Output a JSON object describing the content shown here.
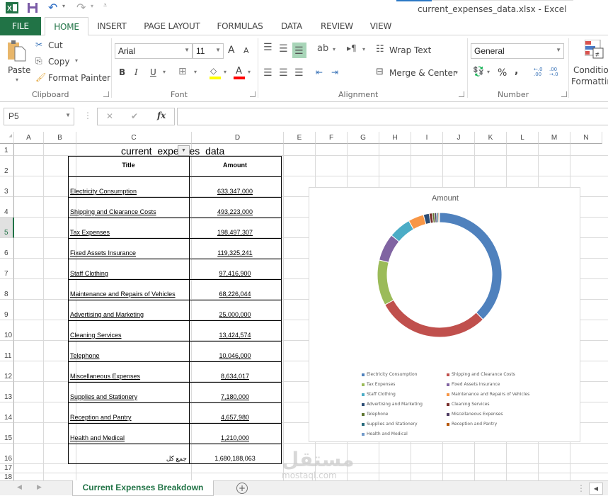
{
  "window": {
    "title": "current_expenses_data.xlsx - Excel"
  },
  "ribbon_tabs": [
    "FILE",
    "HOME",
    "INSERT",
    "PAGE LAYOUT",
    "FORMULAS",
    "DATA",
    "REVIEW",
    "VIEW"
  ],
  "active_tab": "HOME",
  "clipboard": {
    "paste": "Paste",
    "cut": "Cut",
    "copy": "Copy",
    "format_painter": "Format Painter",
    "label": "Clipboard"
  },
  "font": {
    "name": "Arial",
    "size": "11",
    "bold": "B",
    "italic": "I",
    "underline": "U",
    "label": "Font",
    "grow": "A",
    "shrink": "A",
    "color_letter": "A",
    "fill_color": "#ffff00",
    "text_color": "#ff0000"
  },
  "alignment": {
    "wrap_text": "Wrap Text",
    "merge_center": "Merge & Center",
    "label": "Alignment"
  },
  "number": {
    "format": "General",
    "percent": "%",
    "comma": ",",
    "inc_decimal": "←.0 .00",
    "dec_decimal": ".00 →.0",
    "label": "Number"
  },
  "styles": {
    "conditional_formatting_1": "Conditior",
    "conditional_formatting_2": "Formattin"
  },
  "formula_bar": {
    "name_box": "P5",
    "cancel": "✕",
    "enter": "✔",
    "fx": "fx",
    "value": ""
  },
  "columns": [
    "A",
    "B",
    "C",
    "D",
    "E",
    "F",
    "G",
    "H",
    "I",
    "J",
    "K",
    "L",
    "M",
    "N"
  ],
  "rows": [
    "1",
    "2",
    "3",
    "4",
    "5",
    "6",
    "7",
    "8",
    "9",
    "10",
    "11",
    "12",
    "13",
    "14",
    "15",
    "16",
    "17",
    "18"
  ],
  "selected_row": "5",
  "sheet": {
    "title": "current_expenses_data",
    "headers": {
      "title": "Title",
      "amount": "Amount"
    },
    "items": [
      {
        "title": "Electricity Consumption",
        "amount": "633,347,000"
      },
      {
        "title": "Shipping and Clearance Costs",
        "amount": "493,223,000"
      },
      {
        "title": "Tax Expenses",
        "amount": "198,497,307"
      },
      {
        "title": "Fixed Assets Insurance",
        "amount": "119,325,241"
      },
      {
        "title": "Staff Clothing",
        "amount": "97,416,900"
      },
      {
        "title": "Maintenance and Repairs of Vehicles",
        "amount": "68,226,044"
      },
      {
        "title": "Advertising and Marketing",
        "amount": "25,000,000"
      },
      {
        "title": "Cleaning Services",
        "amount": "13,424,574"
      },
      {
        "title": "Telephone",
        "amount": "10,046,000"
      },
      {
        "title": "Miscellaneous Expenses",
        "amount": "8,634,017"
      },
      {
        "title": "Supplies and Stationery",
        "amount": "7,180,000"
      },
      {
        "title": "Reception and Pantry",
        "amount": "4,657,980"
      },
      {
        "title": "Health and Medical",
        "amount": "1,210,000"
      }
    ],
    "total_label": "جمع کل",
    "total_amount": "1,680,188,063"
  },
  "chart_data": {
    "type": "pie",
    "variant": "doughnut",
    "title": "Amount",
    "categories": [
      "Electricity Consumption",
      "Shipping and Clearance Costs",
      "Tax Expenses",
      "Fixed Assets Insurance",
      "Staff Clothing",
      "Maintenance and Repairs of Vehicles",
      "Advertising and Marketing",
      "Cleaning Services",
      "Telephone",
      "Miscellaneous Expenses",
      "Supplies and Stationery",
      "Reception and Pantry",
      "Health and Medical"
    ],
    "values": [
      633347000,
      493223000,
      198497307,
      119325241,
      97416900,
      68226044,
      25000000,
      13424574,
      10046000,
      8634017,
      7180000,
      4657980,
      1210000
    ],
    "colors": [
      "#4f81bd",
      "#c0504d",
      "#9bbb59",
      "#8064a2",
      "#4bacc6",
      "#f79646",
      "#2c4d75",
      "#772c2a",
      "#5f7530",
      "#4d3b62",
      "#276a7c",
      "#b65708",
      "#729aca"
    ],
    "legend_position": "bottom"
  },
  "sheet_tabs": {
    "active": "Current Expenses Breakdown",
    "add": "+"
  },
  "watermark": {
    "arabic": "مستقل",
    "latin": "mostaql.com"
  }
}
